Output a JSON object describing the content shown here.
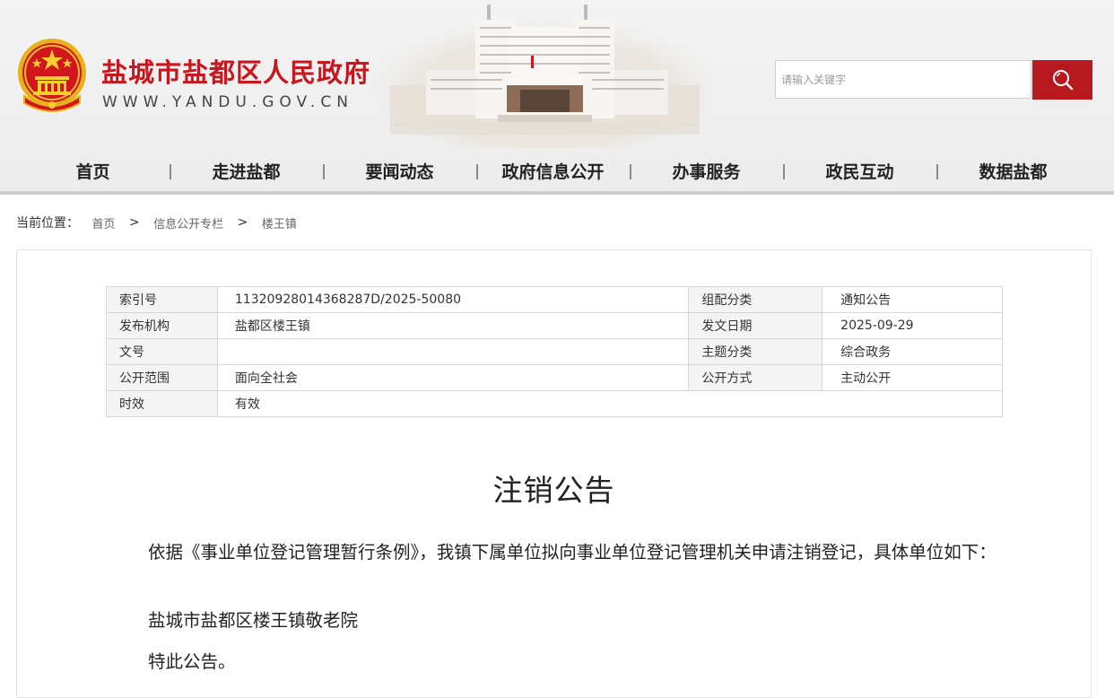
{
  "header": {
    "site_title": "盐城市盐都区人民政府",
    "site_domain": "WWW.YANDU.GOV.CN",
    "search_placeholder": "请输入关键字"
  },
  "nav": {
    "items": [
      "首页",
      "走进盐都",
      "要闻动态",
      "政府信息公开",
      "办事服务",
      "政民互动",
      "数据盐都"
    ]
  },
  "breadcrumb": {
    "label": "当前位置：",
    "links": [
      "首页",
      "信息公开专栏",
      "楼王镇"
    ],
    "separator": ">"
  },
  "meta": {
    "index_no_label": "索引号",
    "index_no": "11320928014368287D/2025-50080",
    "category_label": "组配分类",
    "category": "通知公告",
    "publisher_label": "发布机构",
    "publisher": "盐都区楼王镇",
    "date_label": "发文日期",
    "date": "2025-09-29",
    "doc_no_label": "文号",
    "doc_no": "",
    "topic_label": "主题分类",
    "topic": "综合政务",
    "scope_label": "公开范围",
    "scope": "面向全社会",
    "method_label": "公开方式",
    "method": "主动公开",
    "validity_label": "时效",
    "validity": "有效"
  },
  "article": {
    "title": "注销公告",
    "paragraphs": [
      "依据《事业单位登记管理暂行条例》，我镇下属单位拟向事业单位登记管理机关申请注销登记，具体单位如下：",
      "盐城市盐都区楼王镇敬老院",
      "特此公告。"
    ]
  },
  "colors": {
    "brand_red": "#c8161e",
    "search_button": "#b8191f"
  },
  "icons": {
    "emblem": "national-emblem-icon",
    "search": "search-icon"
  }
}
